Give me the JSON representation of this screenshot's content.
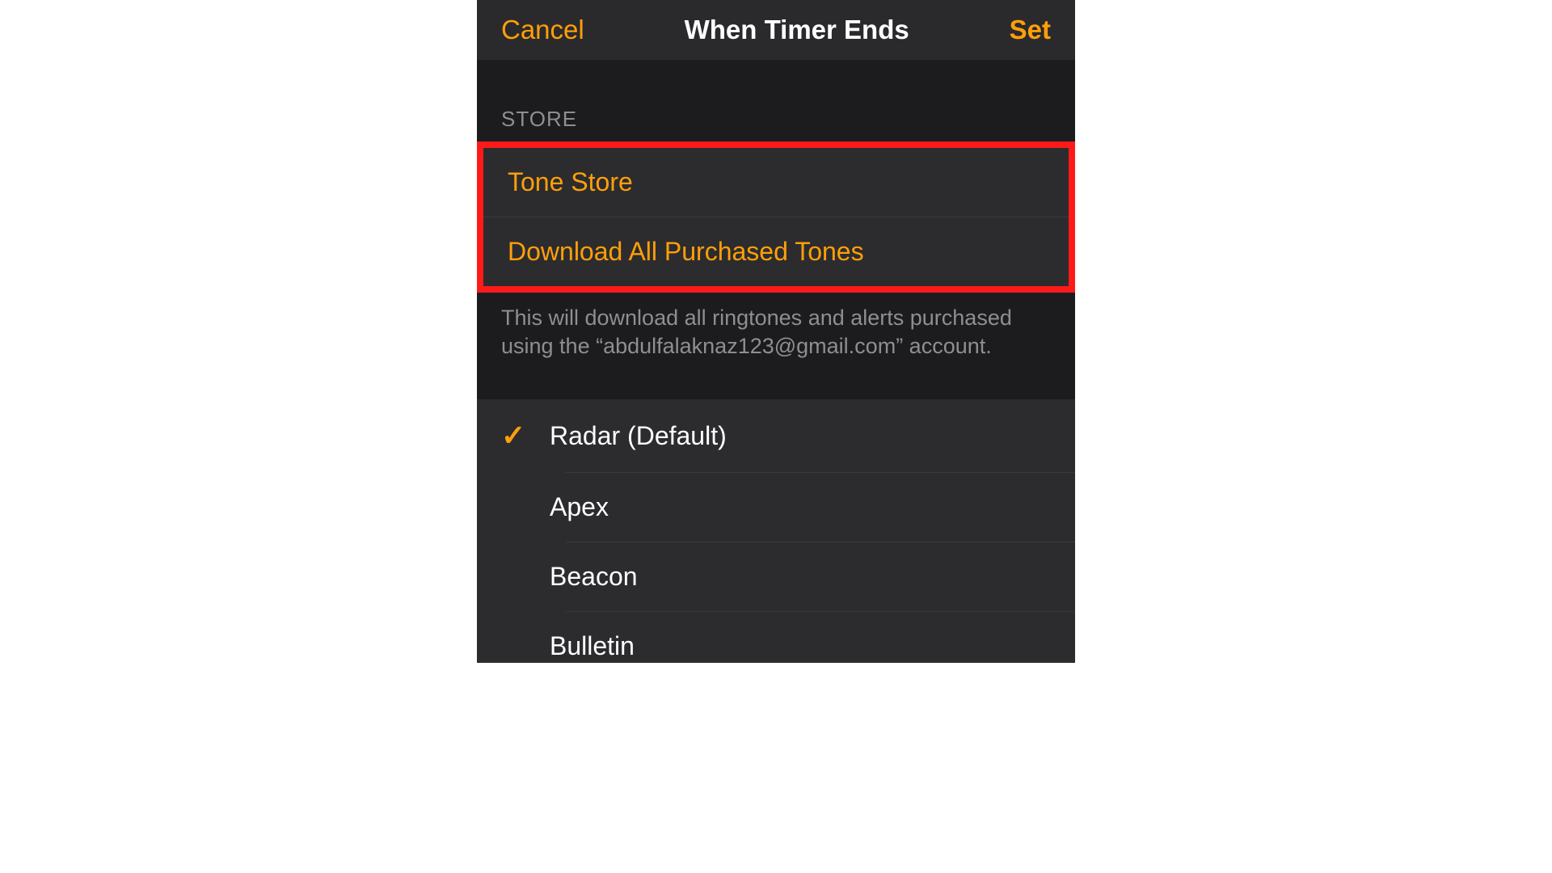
{
  "nav": {
    "cancel": "Cancel",
    "title": "When Timer Ends",
    "set": "Set"
  },
  "store_section": {
    "header": "STORE",
    "tone_store": "Tone Store",
    "download_all": "Download All Purchased Tones",
    "footer": "This will download all ringtones and alerts purchased using the “abdulfalaknaz123@gmail.com” account."
  },
  "ringtones": [
    {
      "label": "Radar (Default)",
      "selected": true
    },
    {
      "label": "Apex",
      "selected": false
    },
    {
      "label": "Beacon",
      "selected": false
    },
    {
      "label": "Bulletin",
      "selected": false
    }
  ],
  "colors": {
    "accent": "#ff9f0a",
    "highlight_border": "#ff1a1a"
  }
}
